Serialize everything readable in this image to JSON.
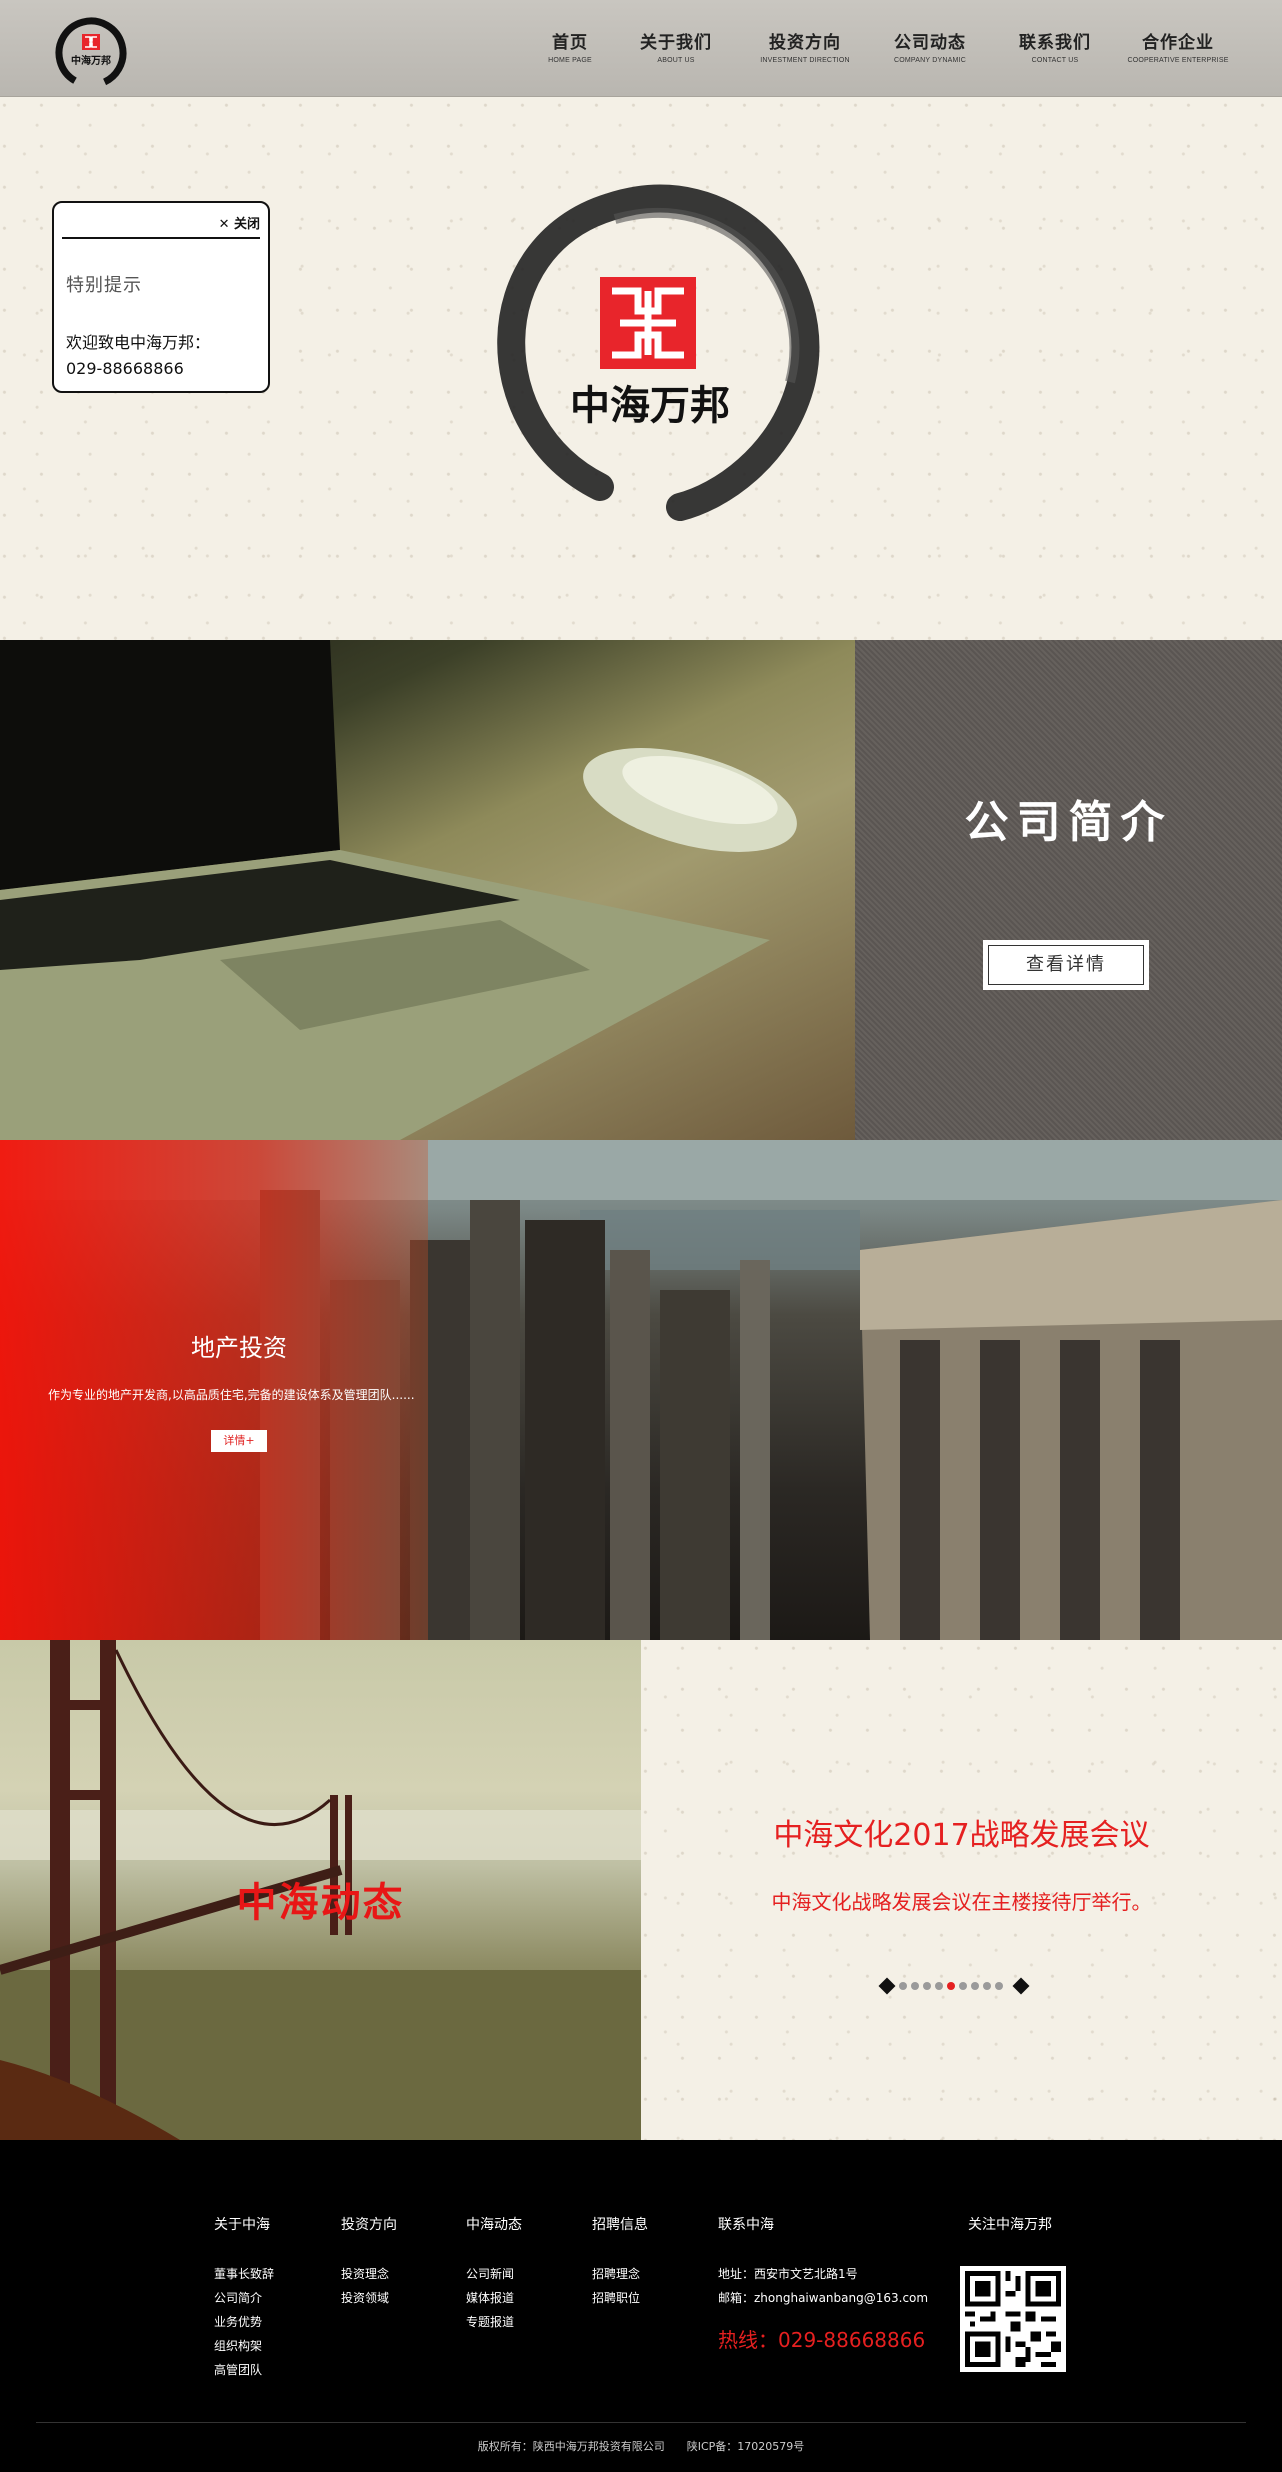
{
  "nav": {
    "items": [
      {
        "label": "首页",
        "sub": "HOME PAGE"
      },
      {
        "label": "关于我们",
        "sub": "ABOUT US"
      },
      {
        "label": "投资方向",
        "sub": "INVESTMENT DIRECTION"
      },
      {
        "label": "公司动态",
        "sub": "COMPANY DYNAMIC"
      },
      {
        "label": "联系我们",
        "sub": "CONTACT US"
      },
      {
        "label": "合作企业",
        "sub": "COOPERATIVE ENTERPRISE"
      }
    ]
  },
  "brand": {
    "name": "中海万邦",
    "red": "#e8252b"
  },
  "popup": {
    "close_label": "✕ 关闭",
    "title": "特别提示",
    "text": "欢迎致电中海万邦：",
    "phone": "029-88668866"
  },
  "intro": {
    "title": "公司简介",
    "button": "查看详情"
  },
  "estate": {
    "title": "地产投资",
    "desc": "作为专业的地产开发商,以高品质住宅,完备的建设体系及管理团队......",
    "button": "详情+"
  },
  "news": {
    "label": "中海动态",
    "title": "中海文化2017战略发展会议",
    "desc": "中海文化战略发展会议在主楼接待厅举行。",
    "dots_total": 9,
    "dots_active": 4
  },
  "footer": {
    "columns": [
      {
        "head": "关于中海",
        "links": [
          "董事长致辞",
          "公司简介",
          "业务优势",
          "组织构架",
          "高管团队"
        ]
      },
      {
        "head": "投资方向",
        "links": [
          "投资理念",
          "投资领域"
        ]
      },
      {
        "head": "中海动态",
        "links": [
          "公司新闻",
          "媒体报道",
          "专题报道"
        ]
      },
      {
        "head": "招聘信息",
        "links": [
          "招聘理念",
          "招聘职位"
        ]
      }
    ],
    "contact": {
      "head": "联系中海",
      "address": "地址：西安市文艺北路1号",
      "email": "邮箱：zhonghaiwanbang@163.com",
      "hotline": "热线：029-88668866"
    },
    "follow": "关注中海万邦",
    "copyright": "版权所有：陕西中海万邦投资有限公司　　陕ICP备：17020579号"
  }
}
